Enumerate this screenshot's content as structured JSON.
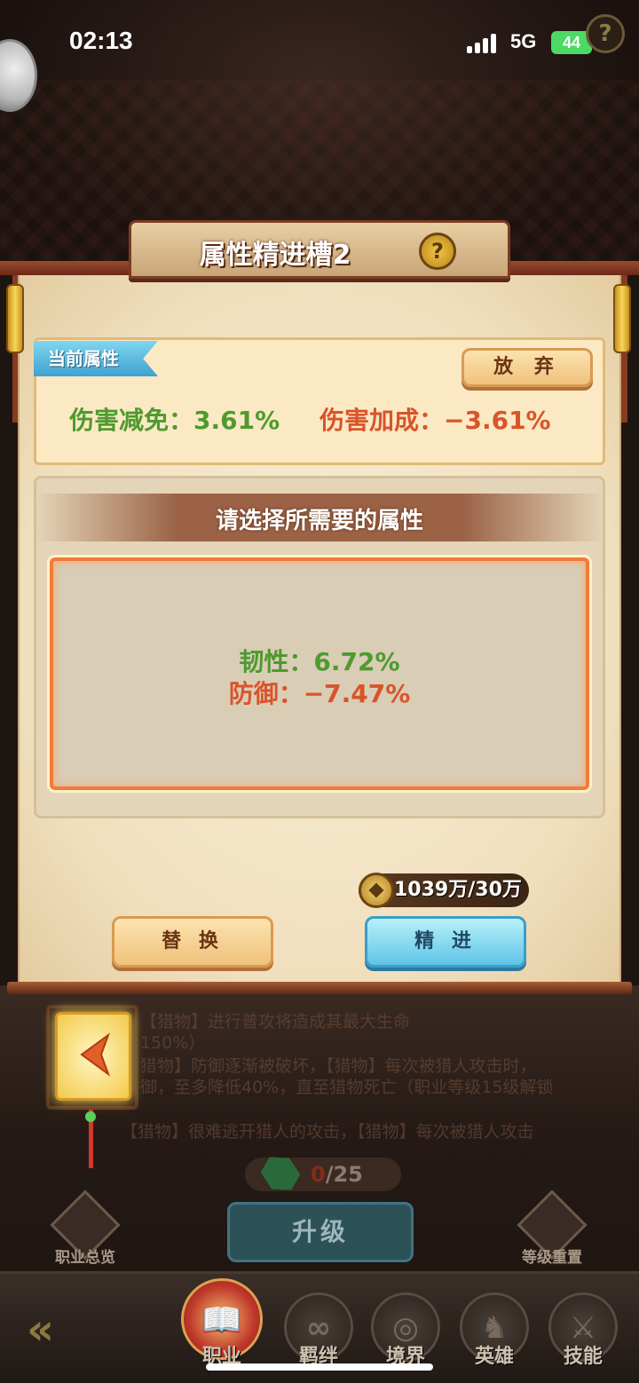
{
  "status_bar": {
    "time": "02:13",
    "network": "5G",
    "battery": "44"
  },
  "dialog": {
    "title": "属性精进槽2",
    "help_glyph": "?",
    "current": {
      "tag": "当前属性",
      "abandon_label": "放 弃",
      "attr1": "伤害减免：3.61%",
      "attr2": "伤害加成：−3.61%"
    },
    "select": {
      "title": "请选择所需要的属性",
      "option_line1": "韧性：6.72%",
      "option_line2": "防御：−7.47%"
    },
    "cost": "1039万/30万",
    "replace_label": "替 换",
    "refine_label": "精 进"
  },
  "background": {
    "line1": "【猎物】进行普攻将造成其最大生命",
    "line2": "150%）",
    "line3": "猎物】防御逐渐被破坏，【猎物】每次被猎人攻击时，",
    "line4": "御，至多降低40%，直至猎物死亡（职业等级15级解锁",
    "line5": "【猎物】很难逃开猎人的攻击，【猎物】每次被猎人攻击",
    "gems_zero": "0",
    "gems_total": "/25",
    "upgrade_label": "升级",
    "overview_label": "职业总览",
    "reset_label": "等级重置"
  },
  "nav": {
    "items": [
      {
        "label": "职业",
        "glyph": "📖"
      },
      {
        "label": "羁绊",
        "glyph": "∞"
      },
      {
        "label": "境界",
        "glyph": "◎"
      },
      {
        "label": "英雄",
        "glyph": "♞"
      },
      {
        "label": "技能",
        "glyph": "⚔"
      }
    ]
  },
  "colors": {
    "positive": "#4f9a2e",
    "negative": "#d9542a",
    "accent_blue": "#5fc4e6",
    "parchment": "#f0dfbd"
  }
}
